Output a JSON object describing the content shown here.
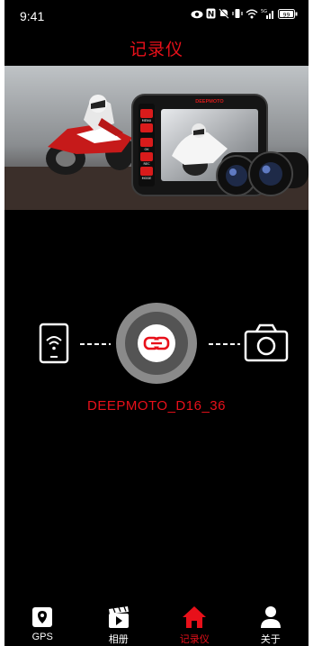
{
  "status_bar": {
    "time": "9:41"
  },
  "header": {
    "title": "记录仪"
  },
  "banner": {
    "brand_text": "DEEPMOTO",
    "button_labels": [
      "MENU",
      "OK",
      "REC",
      "MODE"
    ]
  },
  "device": {
    "name": "DEEPMOTO_D16_36"
  },
  "colors": {
    "accent": "#e8101a",
    "background": "#000000"
  },
  "tabs": [
    {
      "label": "GPS",
      "icon": "location-pin-icon",
      "active": false
    },
    {
      "label": "相册",
      "icon": "video-album-icon",
      "active": false
    },
    {
      "label": "记录仪",
      "icon": "home-icon",
      "active": true
    },
    {
      "label": "关于",
      "icon": "person-icon",
      "active": false
    }
  ]
}
